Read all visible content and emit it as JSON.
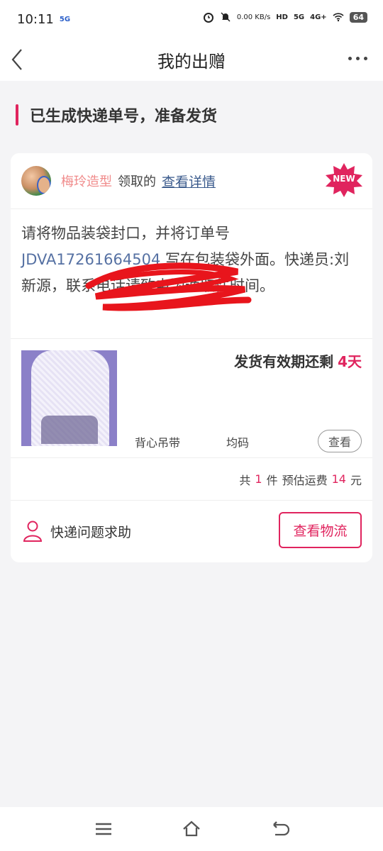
{
  "status_bar": {
    "time": "10:11",
    "carrier": "5G",
    "network_speed": "0.00 KB/s",
    "hd_label": "HD",
    "signal_5g": "5G",
    "signal_4g": "4G+",
    "battery": "64"
  },
  "nav": {
    "title": "我的出赠"
  },
  "section": {
    "title": "已生成快递单号，准备发货",
    "accent_color": "#e0245e"
  },
  "card": {
    "giver_name": "梅玲造型",
    "receive_text": "领取的",
    "detail_link": "查看详情",
    "badge": "NEW",
    "instruction_part1": "请将物品装袋封口，并将订单号",
    "order_number": "JDVA17261664504",
    "instruction_part2": "写在包装袋外面。快递员:刘新源，联系电话",
    "instruction_part3": "请致电沟通取件时间。",
    "expire_label": "发货有效期还剩",
    "expire_days": "4天",
    "item_variant": "背心吊带",
    "item_size": "均码",
    "view_button": "查看",
    "summary": {
      "prefix": "共",
      "count": "1",
      "count_unit": "件",
      "fee_label": "预估运费",
      "fee": "14",
      "fee_unit": "元"
    },
    "help_text": "快递问题求助",
    "logistics_button": "查看物流"
  },
  "icons": {
    "back": "chevron-left-icon",
    "more": "more-dots-icon",
    "person": "person-outline-icon",
    "menu": "menu-icon",
    "home": "home-icon",
    "return": "back-arrow-icon"
  }
}
